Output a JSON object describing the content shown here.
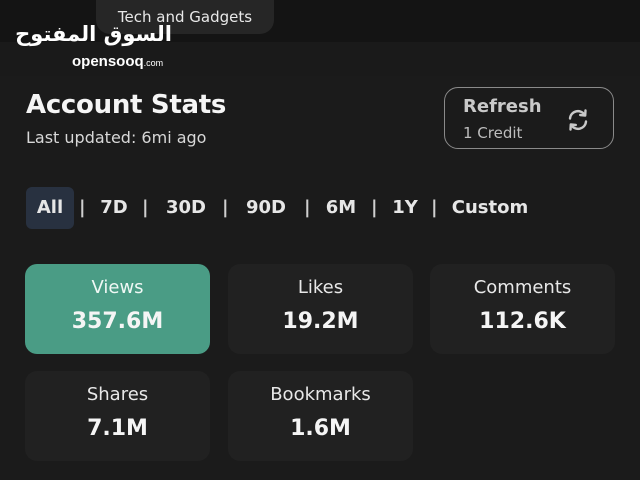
{
  "header": {
    "category": "Tech and Gadgets",
    "logo_arabic": "السوق المفتوح",
    "logo_latin": "opensooq",
    "logo_suffix": ".com"
  },
  "stats": {
    "title": "Account Stats",
    "last_updated": "Last updated: 6mi ago",
    "refresh": {
      "label": "Refresh",
      "sub": "1 Credit",
      "icon": "refresh-icon"
    }
  },
  "ranges": {
    "active": "All",
    "items": [
      "All",
      "7D",
      "30D",
      "90D",
      "6M",
      "1Y",
      "Custom"
    ],
    "separator": "|"
  },
  "cards": [
    {
      "label": "Views",
      "value": "357.6M",
      "selected": true
    },
    {
      "label": "Likes",
      "value": "19.2M",
      "selected": false
    },
    {
      "label": "Comments",
      "value": "112.6K",
      "selected": false
    },
    {
      "label": "Shares",
      "value": "7.1M",
      "selected": false
    },
    {
      "label": "Bookmarks",
      "value": "1.6M",
      "selected": false
    }
  ],
  "colors": {
    "background": "#1a1a1a",
    "card": "#212121",
    "card_selected": "#4a9c85",
    "tab_active": "#283140",
    "refresh_border": "#8a8a8a"
  }
}
